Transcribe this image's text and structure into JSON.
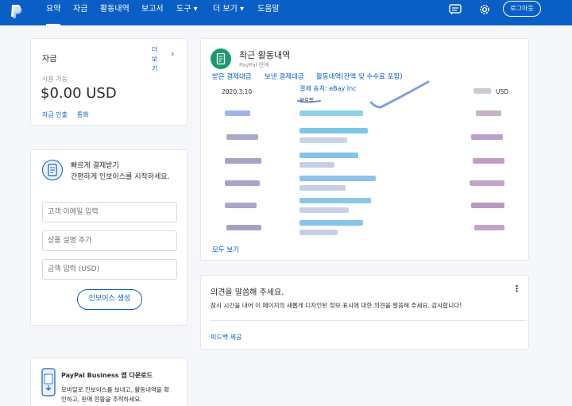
{
  "nav": {
    "items": [
      "요약",
      "자금",
      "활동내역",
      "보고서",
      "도구 ▾",
      "더 보기 ▾",
      "도움말"
    ],
    "logout": "로그아웃",
    "icons": [
      "message-icon",
      "gear-icon"
    ]
  },
  "balance": {
    "label": "자금",
    "more": "더 보기",
    "available_label": "사용 가능",
    "amount": "$0.00 USD",
    "transfer": "자금 인출",
    "currency": "통화"
  },
  "invoice": {
    "title": "빠르게 결제받기",
    "subtitle": "간편하게 인보이스를 시작하세요.",
    "email_placeholder": "고객 이메일 입력",
    "item_placeholder": "상품 설명 추가",
    "amount_placeholder": "금액 입력 (USD)",
    "create_button": "인보이스 생성"
  },
  "app_promo": {
    "title": "PayPal Business 앱 다운로드",
    "body_line1": "모바일로 인보이스를 보내고, 활동내역을 확",
    "body_line2": "인하고, 판매 현황을 추적하세요."
  },
  "activity": {
    "title": "최근 활동내역",
    "subtitle": "PayPal 잔액",
    "tabs": [
      "받은 결제대금",
      "보낸 결제대금",
      "활동내역(잔액 및 수수료 포함)"
    ],
    "row": {
      "date": "2020.3.10",
      "description": "결제 송치: eBay Inc",
      "status": "완료됨",
      "currency": "USD"
    },
    "view_all": "모두 보기"
  },
  "feedback": {
    "title": "의견을 말씀해 주세요.",
    "body": "잠시 시간을 내어 이 페이지의 새롭게 디자인된 정보 표시에 대한 의견을 말씀해 주세요. 감사합니다!",
    "link": "피드백 제공"
  },
  "colors": {
    "nav_bg": "#0a5fc7",
    "link": "#0a5fc7",
    "accent_green": "#1a9b6e",
    "annotation": "#6a8fd6"
  }
}
